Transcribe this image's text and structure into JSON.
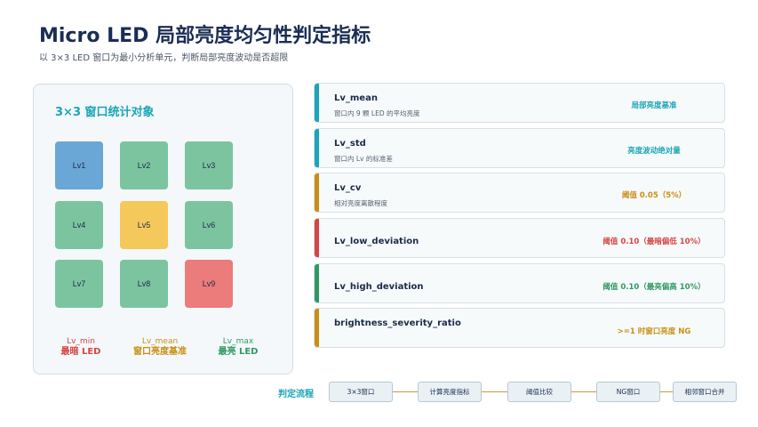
{
  "header": {
    "title": "Micro LED 局部亮度均匀性判定指标",
    "subtitle": "以 3×3 LED 窗口为最小分析单元，判断局部亮度波动是否超限"
  },
  "grid": {
    "title": "3×3 窗口统计对象",
    "cells": [
      {
        "label": "Lv1",
        "color": "#6aa6d6"
      },
      {
        "label": "Lv2",
        "color": "#7cc4a0"
      },
      {
        "label": "Lv3",
        "color": "#7cc4a0"
      },
      {
        "label": "Lv4",
        "color": "#7cc4a0"
      },
      {
        "label": "Lv5",
        "color": "#f5c85c"
      },
      {
        "label": "Lv6",
        "color": "#7cc4a0"
      },
      {
        "label": "Lv7",
        "color": "#7cc4a0"
      },
      {
        "label": "Lv8",
        "color": "#7cc4a0"
      },
      {
        "label": "Lv9",
        "color": "#ec7b7b"
      }
    ],
    "legend": [
      {
        "line1": "Lv_min",
        "line2": "最暗 LED",
        "color": "#d64545"
      },
      {
        "line1": "Lv_mean",
        "line2": "窗口亮度基准",
        "color": "#c98f14"
      },
      {
        "line1": "Lv_max",
        "line2": "最亮 LED",
        "color": "#2e9a62"
      }
    ]
  },
  "metrics": [
    {
      "name": "Lv_mean",
      "desc": "窗口内 9 颗 LED 的平均亮度",
      "tag": "局部亮度基准",
      "color": "#1aa5b8"
    },
    {
      "name": "Lv_std",
      "desc": "窗口内 Lv 的标准差",
      "tag": "亮度波动绝对量",
      "color": "#1aa5b8"
    },
    {
      "name": "Lv_cv",
      "desc": "相对亮度离散程度",
      "tag": "阈值 0.05（5%）",
      "color": "#c98f14"
    },
    {
      "name": "Lv_low_deviation",
      "desc": "",
      "tag": "阈值 0.10（最暗偏低 10%）",
      "color": "#d64545"
    },
    {
      "name": "Lv_high_deviation",
      "desc": "",
      "tag": "阈值 0.10（最亮偏高 10%）",
      "color": "#2e9a62"
    },
    {
      "name": "brightness_severity_ratio",
      "desc": "",
      "tag": ">=1 时窗口亮度 NG",
      "color": "#c98f14"
    }
  ],
  "flow": {
    "label": "判定流程",
    "steps": [
      "3×3窗口",
      "计算亮度指标",
      "阈值比较",
      "NG窗口",
      "相邻窗口合并"
    ]
  }
}
